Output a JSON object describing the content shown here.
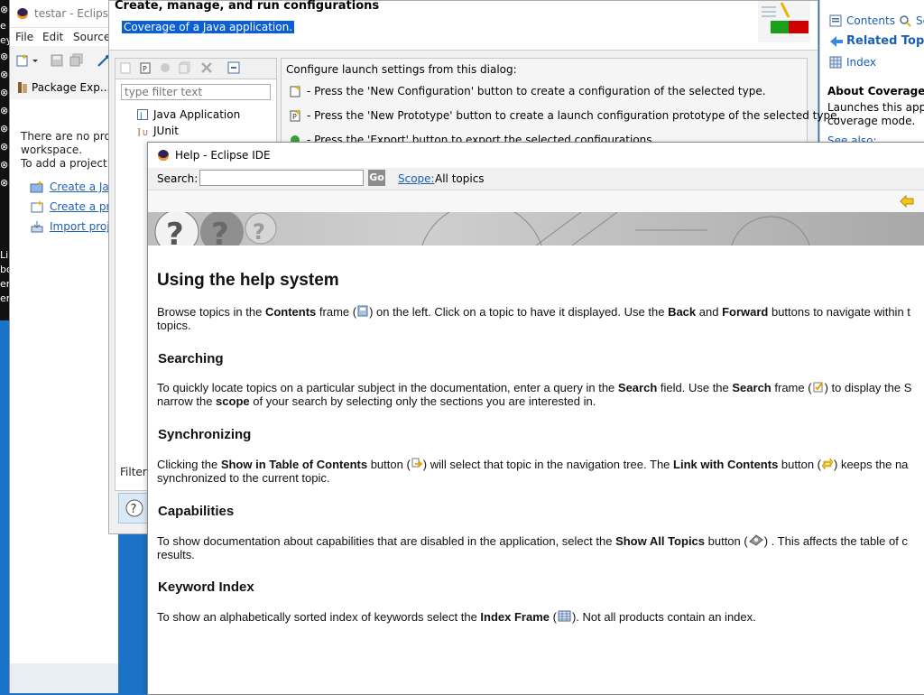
{
  "desktop": {
    "left_glyphs": [
      "⊗",
      "e",
      "ey",
      "⊗",
      "⊗",
      "⊗",
      "⊗",
      "⊗",
      "⊗",
      "⊗",
      "⊗",
      "Li",
      "bo",
      "er",
      "er"
    ]
  },
  "eclipse": {
    "title": "testar - Eclipse I",
    "menu": [
      "File",
      "Edit",
      "Source"
    ],
    "package_explorer": {
      "tab_label": "Package Exp...",
      "empty_lines": [
        "There are no projec",
        "workspace.",
        "To add a project:"
      ],
      "links": [
        "Create a Java",
        "Create a proj",
        "Import proje"
      ]
    }
  },
  "launch_dialog": {
    "title": "Create, manage, and run configurations",
    "subtitle": "Coverage of a Java application.",
    "filter_placeholder": "type filter text",
    "tree": [
      "Java Application",
      "JUnit"
    ],
    "filter_status": "Filter r",
    "intro": "Configure launch settings from this dialog:",
    "instructions": [
      "- Press the 'New Configuration' button to create a configuration of the selected type.",
      "- Press the 'New Prototype' button to create a launch configuration prototype of the selected type.",
      "- Press the 'Export' button to export the selected configurations."
    ]
  },
  "help_view": {
    "tabs": {
      "contents": "Contents",
      "search": "Se",
      "related": "Related Topics",
      "index": "Index"
    },
    "section_title": "About Coverage Co",
    "desc_lines": [
      "Launches this applic",
      "coverage mode."
    ],
    "see_also": "See also:"
  },
  "help_window": {
    "title": "Help - Eclipse IDE",
    "search_label": "Search:",
    "search_value": "",
    "go_label": "Go",
    "scope_label": "Scope:",
    "scope_value": "All topics",
    "content": {
      "heading": "Using the help system",
      "intro": {
        "t1": "Browse topics in the ",
        "b1": "Contents",
        "t2": " frame (",
        "t3": ") on the left. Click on a topic to have it displayed. Use the ",
        "b2": "Back",
        "t4": " and ",
        "b3": "Forward",
        "t5": " buttons to navigate within t",
        "line2": "topics."
      },
      "searching": {
        "heading": "Searching",
        "t1": "To quickly locate topics on a particular subject in the documentation, enter a query in the ",
        "b1": "Search",
        "t2": " field. Use the ",
        "b2": "Search",
        "t3": " frame (",
        "t4": ") to display the S",
        "line2_t1": "narrow the ",
        "line2_b1": "scope",
        "line2_t2": " of your search by selecting only the sections you are interested in."
      },
      "synchronizing": {
        "heading": "Synchronizing",
        "t1": "Clicking the ",
        "b1": "Show in Table of Contents",
        "t2": " button (",
        "t3": ") will select that topic in the navigation tree. The ",
        "b2": "Link with Contents",
        "t4": " button (",
        "t5": ") keeps the na",
        "line2": "synchronized to the current topic."
      },
      "capabilities": {
        "heading": "Capabilities",
        "t1": "To show documentation about capabilities that are disabled in the application, select the ",
        "b1": "Show All Topics",
        "t2": " button (",
        "t3": ") . This affects the table of c",
        "line2": "results."
      },
      "keyword_index": {
        "heading": "Keyword Index",
        "t1": "To show an alphabetically sorted index of keywords select the ",
        "b1": "Index Frame",
        "t2": " (",
        "t3": "). Not all products contain an index."
      }
    }
  }
}
